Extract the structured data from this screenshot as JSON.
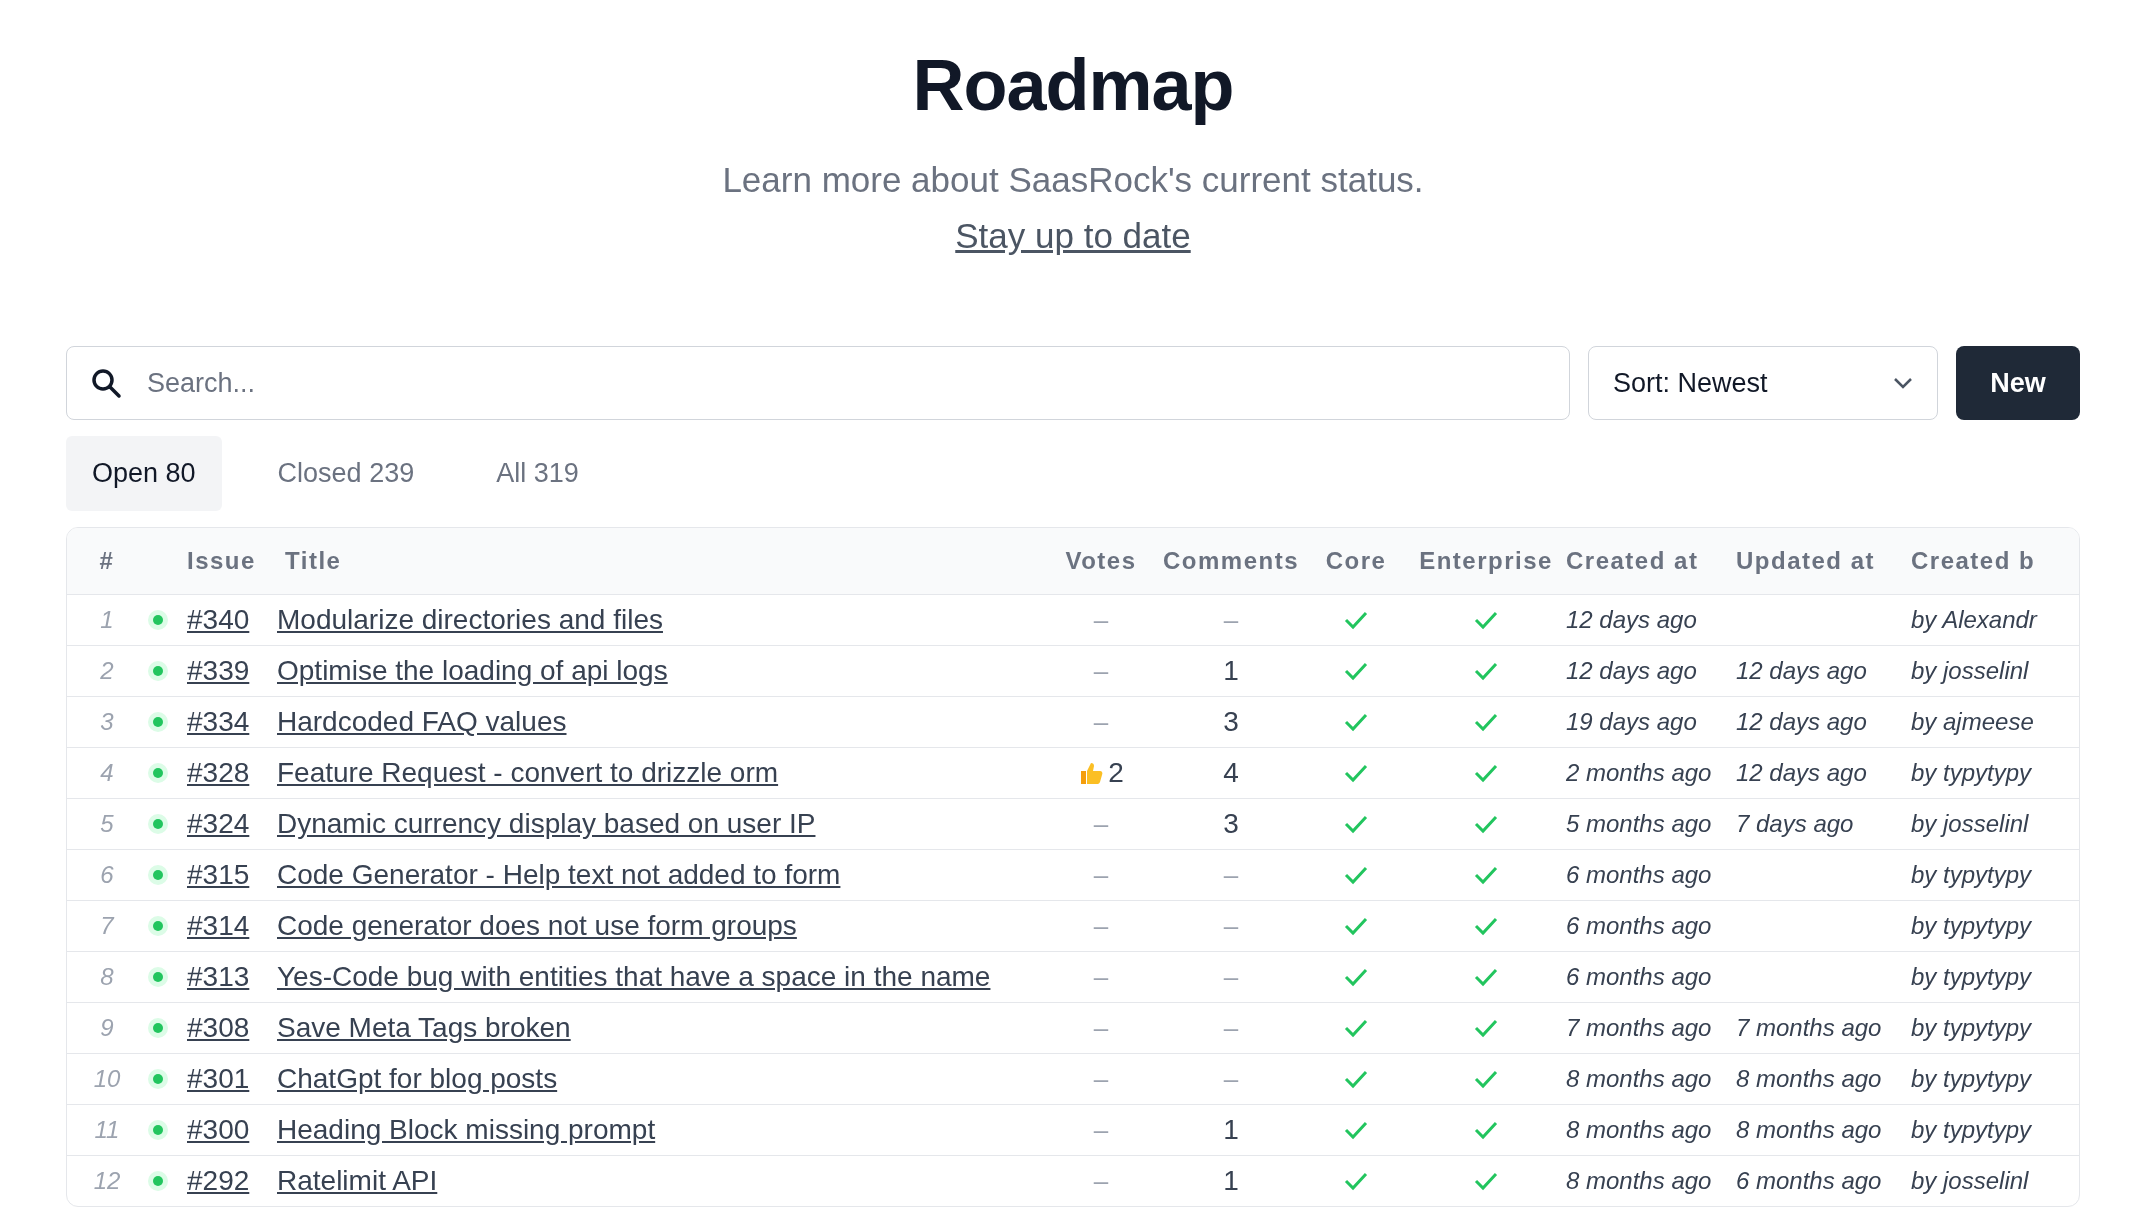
{
  "header": {
    "title": "Roadmap",
    "subtitle": "Learn more about SaasRock's current status.",
    "link": "Stay up to date"
  },
  "toolbar": {
    "search": {
      "placeholder": "Search..."
    },
    "sort": "Sort: Newest",
    "new_button": "New"
  },
  "tabs": [
    {
      "label": "Open 80",
      "selected": true
    },
    {
      "label": "Closed 239",
      "selected": false
    },
    {
      "label": "All 319",
      "selected": false
    }
  ],
  "table": {
    "columns": [
      "#",
      "Issue",
      "Title",
      "Votes",
      "Comments",
      "Core",
      "Enterprise",
      "Created at",
      "Updated at",
      "Created b"
    ],
    "rows": [
      {
        "number": "1",
        "open": true,
        "issue": "#340",
        "title": "Modularize directories and files",
        "votes": "–",
        "thumbs_up": false,
        "comments": "–",
        "core": true,
        "enterprise": true,
        "created_at": "12 days ago",
        "created_by": "by Alexandr"
      },
      {
        "number": "2",
        "open": true,
        "issue": "#339",
        "title": "Optimise the loading of api logs",
        "votes": "–",
        "thumbs_up": false,
        "comments": "1",
        "core": true,
        "enterprise": true,
        "created_at": "12 days ago",
        "updated_at": "12 days ago",
        "created_by": "by josselinl"
      },
      {
        "number": "3",
        "open": true,
        "issue": "#334",
        "title": "Hardcoded FAQ values",
        "votes": "–",
        "thumbs_up": false,
        "comments": "3",
        "core": true,
        "enterprise": true,
        "created_at": "19 days ago",
        "updated_at": "12 days ago",
        "created_by": "by ajmeese"
      },
      {
        "number": "4",
        "open": true,
        "issue": "#328",
        "title": "Feature Request - convert to drizzle orm",
        "votes": "2",
        "thumbs_up": true,
        "comments": "4",
        "core": true,
        "enterprise": true,
        "created_at": "2 months ago",
        "updated_at": "12 days ago",
        "created_by": "by typytypy"
      },
      {
        "number": "5",
        "open": true,
        "issue": "#324",
        "title": "Dynamic currency display based on user IP",
        "votes": "–",
        "thumbs_up": false,
        "comments": "3",
        "core": true,
        "enterprise": true,
        "created_at": "5 months ago",
        "updated_at": "7 days ago",
        "created_by": "by josselinl"
      },
      {
        "number": "6",
        "open": true,
        "issue": "#315",
        "title": "Code Generator - Help text not added to form",
        "votes": "–",
        "thumbs_up": false,
        "comments": "–",
        "core": true,
        "enterprise": true,
        "created_at": "6 months ago",
        "created_by": "by typytypy"
      },
      {
        "number": "7",
        "open": true,
        "issue": "#314",
        "title": "Code generator does not use form groups",
        "votes": "–",
        "thumbs_up": false,
        "comments": "–",
        "core": true,
        "enterprise": true,
        "created_at": "6 months ago",
        "created_by": "by typytypy"
      },
      {
        "number": "8",
        "open": true,
        "issue": "#313",
        "title": "Yes-Code bug with entities that have a space in the name",
        "votes": "–",
        "thumbs_up": false,
        "comments": "–",
        "core": true,
        "enterprise": true,
        "created_at": "6 months ago",
        "created_by": "by typytypy"
      },
      {
        "number": "9",
        "open": true,
        "issue": "#308",
        "title": "Save Meta Tags broken",
        "votes": "–",
        "thumbs_up": false,
        "comments": "–",
        "core": true,
        "enterprise": true,
        "created_at": "7 months ago",
        "updated_at": "7 months ago",
        "created_by": "by typytypy"
      },
      {
        "number": "10",
        "open": true,
        "issue": "#301",
        "title": "ChatGpt for blog posts",
        "votes": "–",
        "thumbs_up": false,
        "comments": "–",
        "core": true,
        "enterprise": true,
        "created_at": "8 months ago",
        "updated_at": "8 months ago",
        "created_by": "by typytypy"
      },
      {
        "number": "11",
        "open": true,
        "issue": "#300",
        "title": "Heading Block missing prompt",
        "votes": "–",
        "thumbs_up": false,
        "comments": "1",
        "core": true,
        "enterprise": true,
        "created_at": "8 months ago",
        "updated_at": "8 months ago",
        "created_by": "by typytypy"
      },
      {
        "number": "12",
        "open": true,
        "issue": "#292",
        "title": "Ratelimit API",
        "votes": "–",
        "thumbs_up": false,
        "comments": "1",
        "core": true,
        "enterprise": true,
        "created_at": "8 months ago",
        "updated_at": "6 months ago",
        "created_by": "by josselinl"
      }
    ]
  }
}
